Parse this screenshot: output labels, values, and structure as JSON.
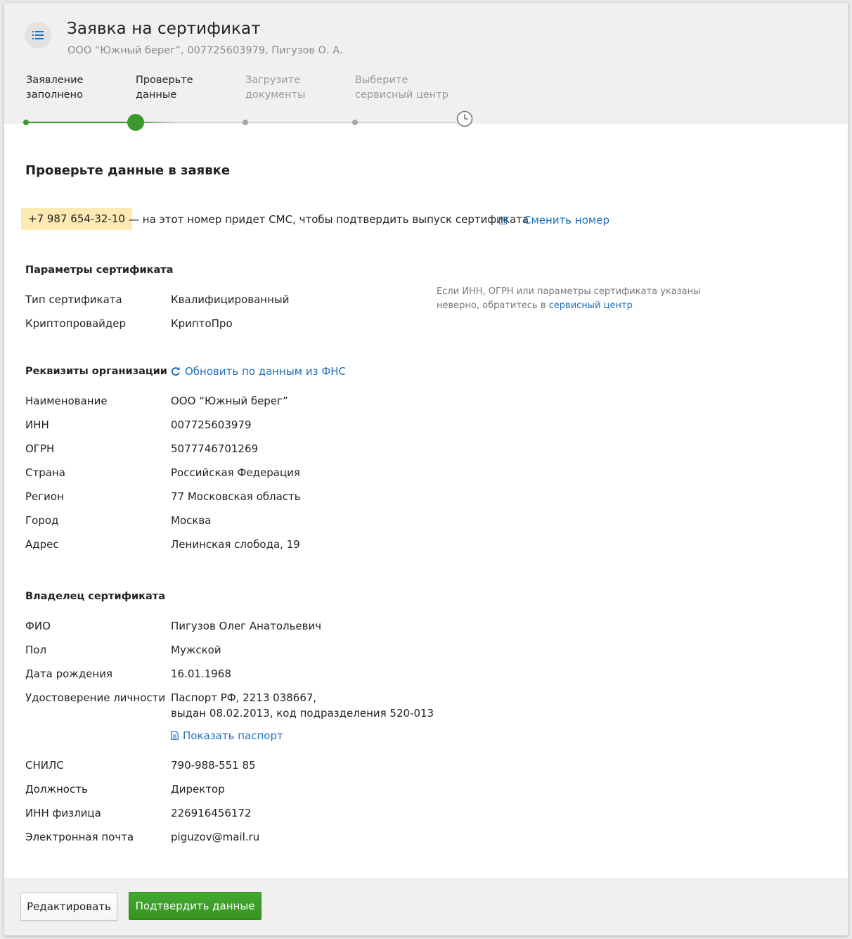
{
  "header": {
    "title": "Заявка на сертификат",
    "subtitle": "ООО “Южный берег”, 007725603979, Пигузов О. А."
  },
  "steps": [
    {
      "line1": "Заявление",
      "line2": "заполнено",
      "state": "done"
    },
    {
      "line1": "Проверьте",
      "line2": "данные",
      "state": "current"
    },
    {
      "line1": "Загрузите",
      "line2": "документы",
      "state": "pending"
    },
    {
      "line1": "Выберите",
      "line2": "сервисный центр",
      "state": "pending"
    }
  ],
  "colors": {
    "accent_green": "#3b9a2c",
    "link_blue": "#1f6fba",
    "phone_highlight": "#fde9b2",
    "pending_gray": "#9a9a9a"
  },
  "main": {
    "heading": "Проверьте данные в заявке",
    "phone": "+7 987 654-32-10",
    "phone_note": "— на этот номер придет СМС, чтобы подтвердить выпуск сертификата",
    "change_phone": "Сменить номер"
  },
  "certificate": {
    "title": "Параметры сертификата",
    "rows": [
      {
        "label": "Тип сертификата",
        "value": "Квалифицированный"
      },
      {
        "label": "Криптопровайдер",
        "value": "КриптоПро"
      }
    ],
    "note_text": "Если ИНН, ОГРН или параметры сертификата указаны неверно, обратитесь в",
    "note_link": "сервисный центр"
  },
  "organization": {
    "title": "Реквизиты организации",
    "refresh_link": "Обновить по данным из ФНС",
    "rows": [
      {
        "label": "Наименование",
        "value": "ООО “Южный берег”"
      },
      {
        "label": "ИНН",
        "value": "007725603979"
      },
      {
        "label": "ОГРН",
        "value": "5077746701269"
      },
      {
        "label": "Страна",
        "value": "Российская Федерация"
      },
      {
        "label": "Регион",
        "value": "77 Московская область"
      },
      {
        "label": "Город",
        "value": "Москва"
      },
      {
        "label": "Адрес",
        "value": "Ленинская слобода, 19"
      }
    ]
  },
  "owner": {
    "title": "Владелец сертификата",
    "rows": [
      {
        "label": "ФИО",
        "value": "Пигузов Олег Анатольевич"
      },
      {
        "label": "Пол",
        "value": "Мужской"
      },
      {
        "label": "Дата рождения",
        "value": "16.01.1968"
      },
      {
        "label": "Удостоверение личности",
        "value": "Паспорт РФ, 2213 038667,",
        "value2": "выдан 08.02.2013, код подразделения 520-013"
      },
      {
        "label": "СНИЛС",
        "value": "790-988-551 85"
      },
      {
        "label": "Должность",
        "value": "Директор"
      },
      {
        "label": "ИНН физлица",
        "value": "226916456172"
      },
      {
        "label": "Электронная почта",
        "value": "piguzov@mail.ru"
      }
    ],
    "show_passport": "Показать паспорт"
  },
  "footer": {
    "edit_label": "Редактировать",
    "confirm_label": "Подтвердить данные"
  }
}
